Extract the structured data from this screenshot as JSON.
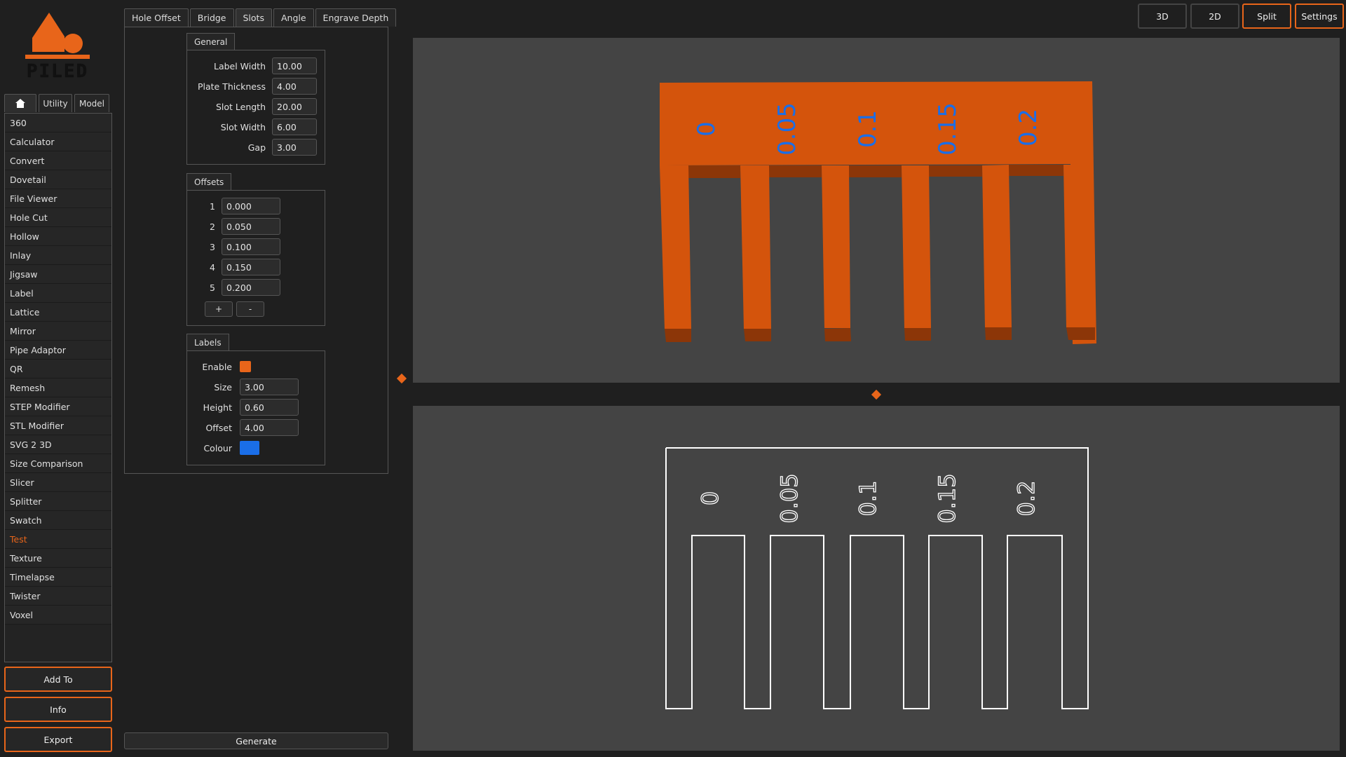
{
  "app": {
    "logo_text": "PILED",
    "accent": "#e8651a",
    "label_colour": "#1a6ee8"
  },
  "left_tabs": [
    {
      "label": "",
      "icon": "home-icon"
    },
    {
      "label": "Utility"
    },
    {
      "label": "Model"
    }
  ],
  "sidebar": {
    "items": [
      "360",
      "Calculator",
      "Convert",
      "Dovetail",
      "File Viewer",
      "Hole Cut",
      "Hollow",
      "Inlay",
      "Jigsaw",
      "Label",
      "Lattice",
      "Mirror",
      "Pipe Adaptor",
      "QR",
      "Remesh",
      "STEP Modifier",
      "STL Modifier",
      "SVG 2 3D",
      "Size Comparison",
      "Slicer",
      "Splitter",
      "Swatch",
      "Test",
      "Texture",
      "Timelapse",
      "Twister",
      "Voxel"
    ],
    "active": "Test"
  },
  "bottom_buttons": {
    "add_to": "Add To",
    "info": "Info",
    "export": "Export"
  },
  "tool_tabs": [
    "Hole Offset",
    "Bridge",
    "Slots",
    "Angle",
    "Engrave Depth"
  ],
  "tool_tab_active": "Slots",
  "general": {
    "title": "General",
    "fields": [
      {
        "label": "Label Width",
        "value": "10.00"
      },
      {
        "label": "Plate Thickness",
        "value": "4.00"
      },
      {
        "label": "Slot Length",
        "value": "20.00"
      },
      {
        "label": "Slot Width",
        "value": "6.00"
      },
      {
        "label": "Gap",
        "value": "3.00"
      }
    ]
  },
  "offsets": {
    "title": "Offsets",
    "rows": [
      {
        "index": "1",
        "value": "0.000"
      },
      {
        "index": "2",
        "value": "0.050"
      },
      {
        "index": "3",
        "value": "0.100"
      },
      {
        "index": "4",
        "value": "0.150"
      },
      {
        "index": "5",
        "value": "0.200"
      }
    ],
    "add_label": "+",
    "remove_label": "-"
  },
  "labels": {
    "title": "Labels",
    "enable_label": "Enable",
    "size_label": "Size",
    "size_value": "3.00",
    "height_label": "Height",
    "height_value": "0.60",
    "offset_label": "Offset",
    "offset_value": "4.00",
    "colour_label": "Colour"
  },
  "generate_label": "Generate",
  "view_buttons": [
    {
      "label": "3D",
      "on": false
    },
    {
      "label": "2D",
      "on": false
    },
    {
      "label": "Split",
      "on": true
    },
    {
      "label": "Settings",
      "on": true
    }
  ],
  "slot_labels": [
    "0",
    "0.05",
    "0.1",
    "0.15",
    "0.2"
  ]
}
